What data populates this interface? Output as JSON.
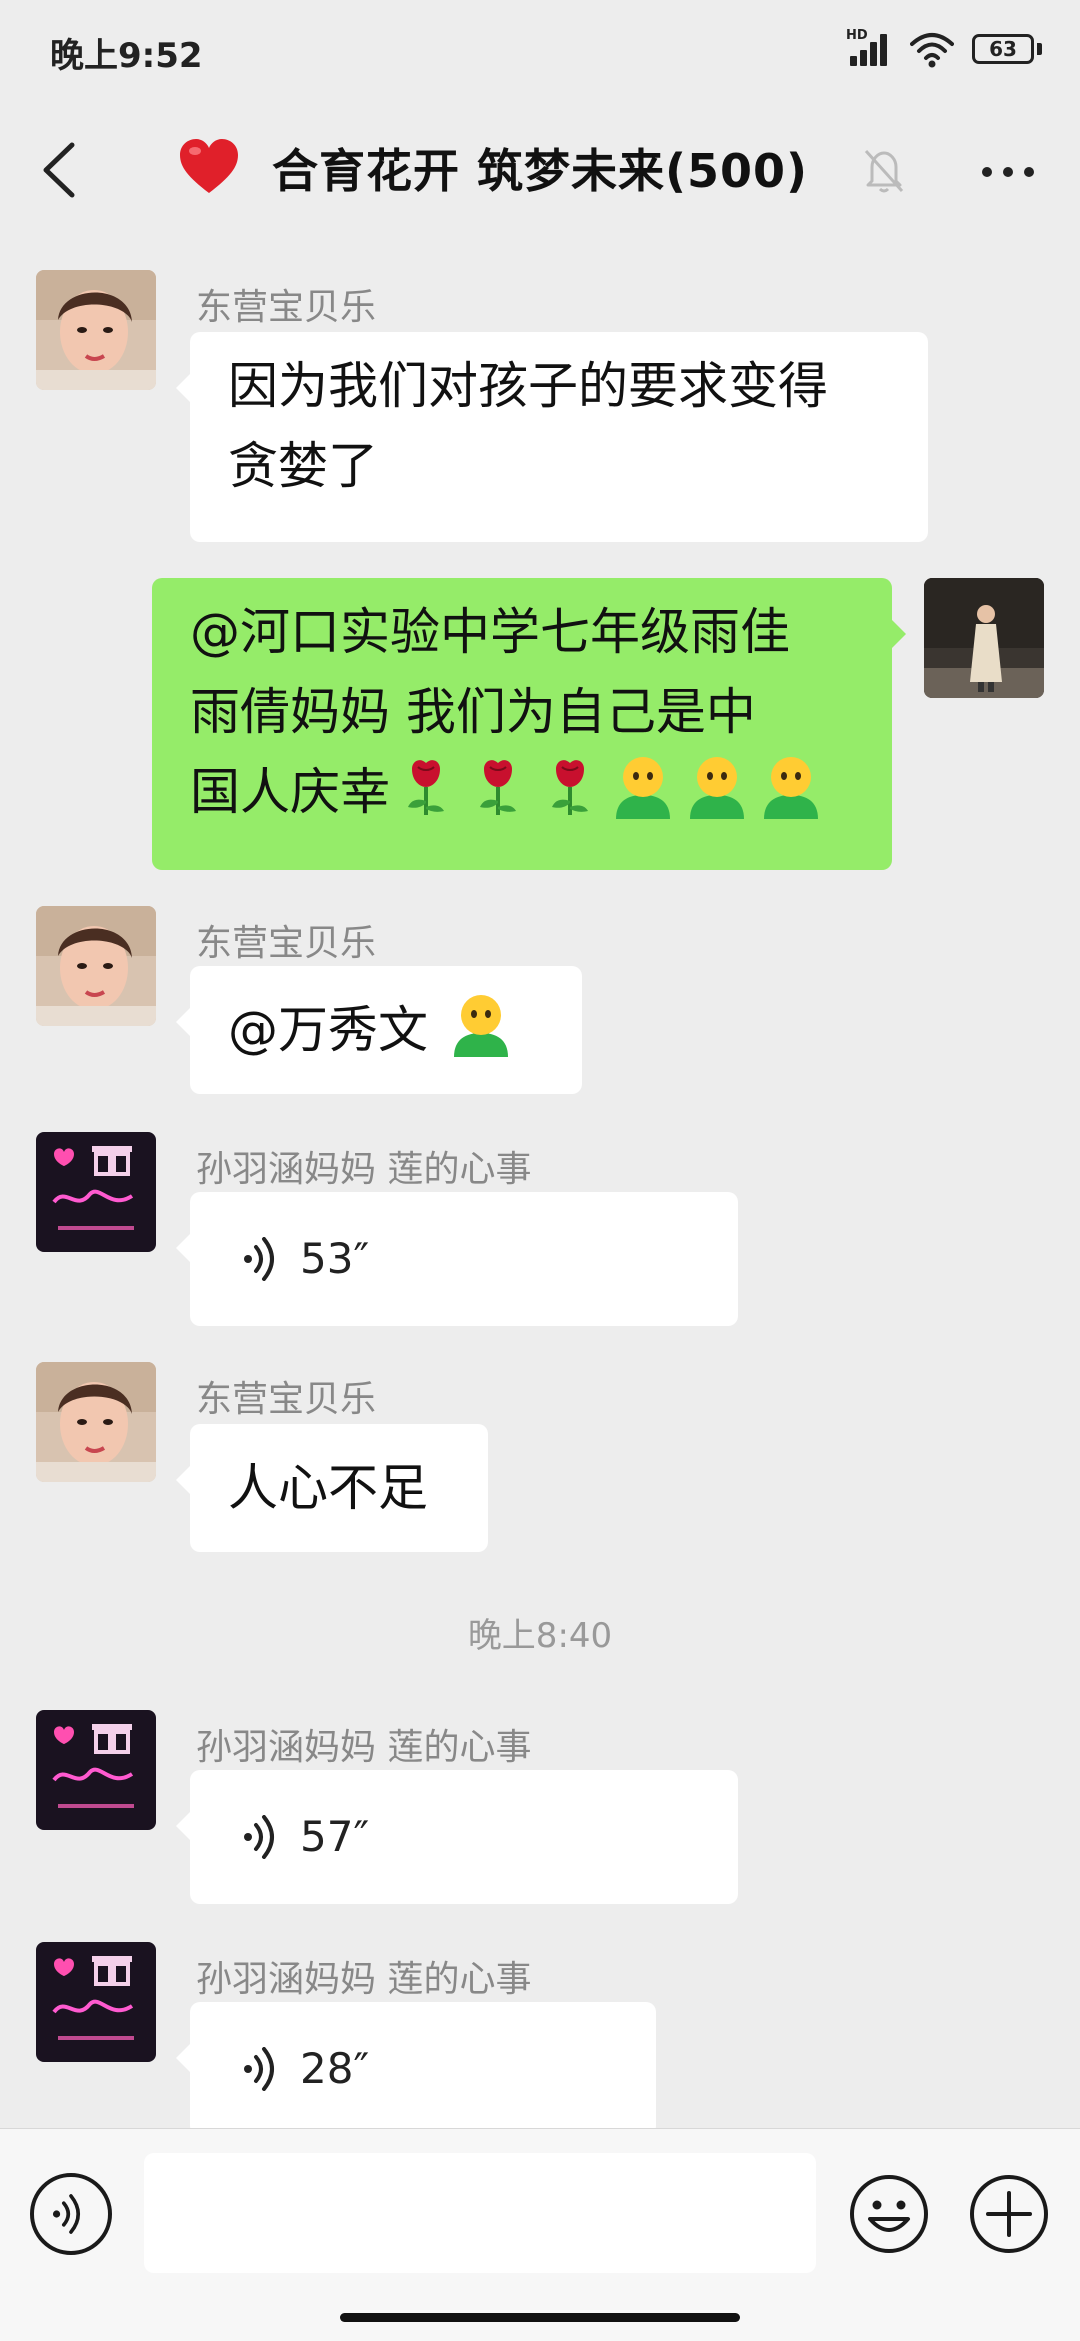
{
  "status_bar": {
    "time": "晚上9:52",
    "network": "HD",
    "battery": "63"
  },
  "header": {
    "title": "合育花开 筑梦未来(500)",
    "heart_icon": "red-heart-emoji",
    "mute_icon": "bell-muted-icon"
  },
  "messages": [
    {
      "sender": "东营宝贝乐",
      "text_line1": "因为我们对孩子的要求变得",
      "text_line2": "贪婪了"
    },
    {
      "line1": "@河口实验中学七年级雨佳",
      "line2": "雨倩妈妈  我们为自己是中",
      "line3": "国人庆幸"
    },
    {
      "sender": "东营宝贝乐",
      "text": "@万秀文 "
    },
    {
      "sender": "孙羽涵妈妈  莲的心事",
      "duration": "53″"
    },
    {
      "sender": "东营宝贝乐",
      "text": "人心不足"
    },
    {
      "sender": "孙羽涵妈妈  莲的心事",
      "duration": "57″"
    },
    {
      "sender": "孙羽涵妈妈  莲的心事",
      "duration": "28″"
    }
  ],
  "timestamp": "晚上8:40",
  "input": {
    "placeholder": ""
  },
  "colors": {
    "background": "#ededed",
    "self_bubble": "#95ec69",
    "other_bubble": "#ffffff"
  }
}
